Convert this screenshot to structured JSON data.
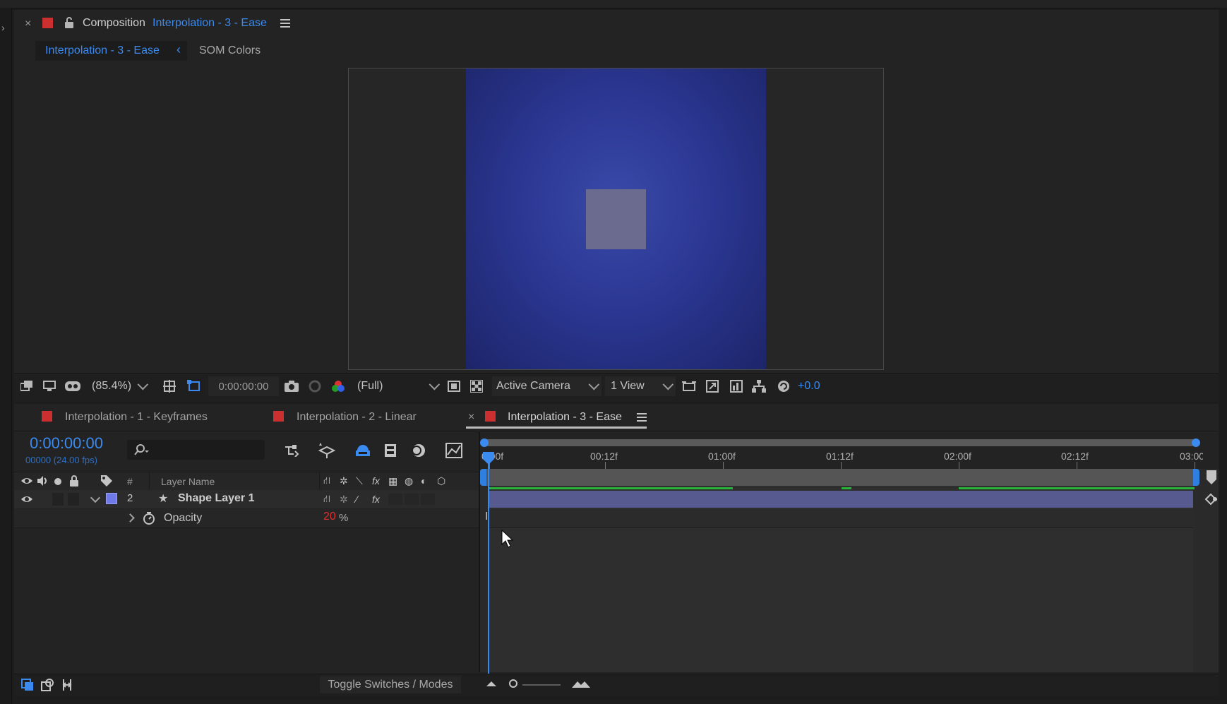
{
  "composition_panel": {
    "panel_title": "Composition",
    "comp_name": "Interpolation - 3 - Ease",
    "breadcrumbs": [
      "Interpolation - 3 - Ease",
      "SOM Colors"
    ],
    "toolbar": {
      "magnification": "(85.4%)",
      "timecode": "0:00:00:00",
      "resolution": "(Full)",
      "camera": "Active Camera",
      "views": "1 View",
      "exposure": "+0.0"
    }
  },
  "timeline_panel": {
    "tabs": [
      {
        "label": "Interpolation - 1 - Keyframes"
      },
      {
        "label": "Interpolation - 2 - Linear"
      },
      {
        "label": "Interpolation - 3 - Ease"
      }
    ],
    "current_time": "0:00:00:00",
    "frame_info": "00000 (24.00 fps)",
    "columns": {
      "number": "#",
      "layer_name": "Layer Name"
    },
    "layer": {
      "index": "2",
      "name": "Shape Layer 1"
    },
    "property": {
      "name": "Opacity",
      "value": "20",
      "unit": "%"
    },
    "ruler_labels": [
      "0:00f",
      "00:12f",
      "01:00f",
      "01:12f",
      "02:00f",
      "02:12f",
      "03:00f"
    ],
    "toggle_label": "Toggle Switches / Modes"
  },
  "colors": {
    "accent_blue": "#3a8af0",
    "label_red": "#cc2f2f",
    "layer_bar": "#565a8e",
    "composition_bg": "#2b3793"
  }
}
